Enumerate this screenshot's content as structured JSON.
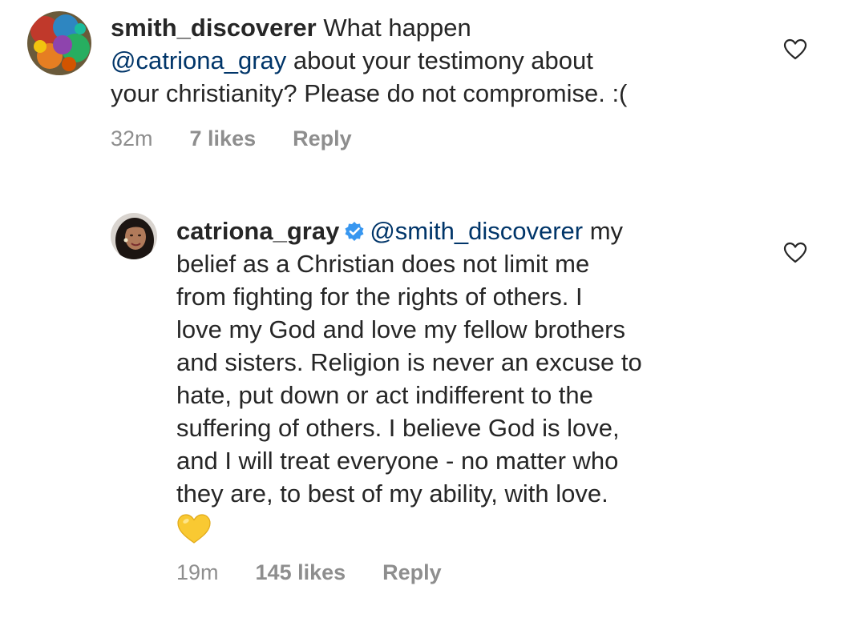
{
  "comments": [
    {
      "username": "smith_discoverer",
      "text_lines": [
        {
          "prefix": "What happen",
          "mention": "",
          "suffix": ""
        },
        {
          "prefix": "",
          "mention": "@catriona_gray",
          "suffix": " about your testimony about"
        },
        {
          "prefix": "your christianity? Please do not compromise. :(",
          "mention": "",
          "suffix": ""
        }
      ],
      "time": "32m",
      "likes": "7 likes",
      "reply_label": "Reply",
      "avatar_icon": "avatar-colorful-abstract",
      "like_icon": "heart-outline-icon"
    },
    {
      "username": "catriona_gray",
      "verified": true,
      "mention": "@smith_discoverer",
      "first_line_suffix": " my",
      "body_lines": [
        "belief as a Christian does not limit me",
        "from fighting for the rights of others. I",
        "love my God and love my fellow brothers",
        "and sisters. Religion is never an excuse to",
        "hate, put down or act indifferent to the",
        "suffering of others. I believe God is love,",
        "and I will treat everyone - no matter who",
        "they are, to best of my ability, with love."
      ],
      "emoji": "yellow-heart",
      "time": "19m",
      "likes": "145 likes",
      "reply_label": "Reply",
      "avatar_icon": "avatar-profile-photo",
      "like_icon": "heart-outline-icon"
    }
  ],
  "colors": {
    "text": "#262626",
    "mention": "#003569",
    "meta": "#8e8e8e",
    "verified": "#3897f0",
    "yellow_heart": "#f9c932"
  }
}
